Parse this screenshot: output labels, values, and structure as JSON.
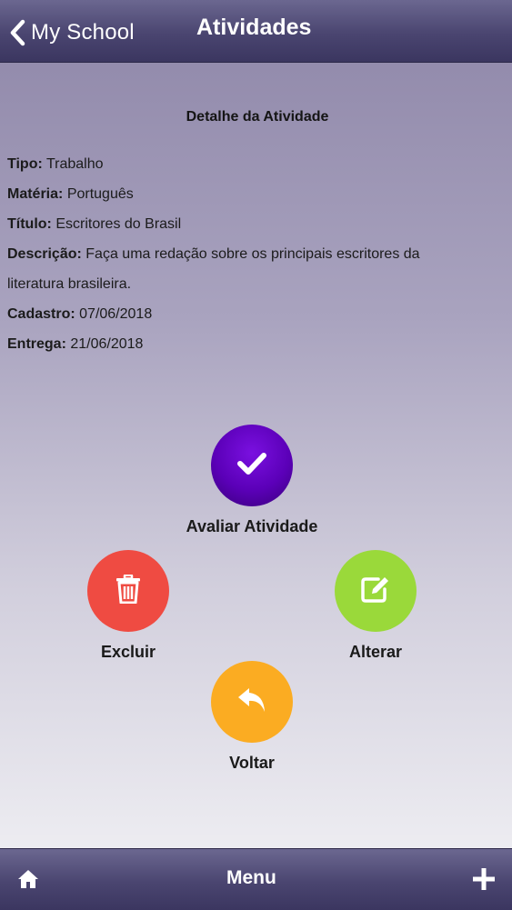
{
  "header": {
    "back_label": "My School",
    "title": "Atividades"
  },
  "detail": {
    "section_title": "Detalhe da Atividade",
    "fields": [
      {
        "label": "Tipo:",
        "value": "Trabalho"
      },
      {
        "label": "Matéria:",
        "value": "Português"
      },
      {
        "label": "Título:",
        "value": "Escritores do Brasil"
      },
      {
        "label": "Descrição:",
        "value": "Faça uma redação sobre os principais escritores da"
      },
      {
        "label": "",
        "value": "literatura brasileira."
      },
      {
        "label": "Cadastro:",
        "value": "07/06/2018"
      },
      {
        "label": "Entrega:",
        "value": "21/06/2018"
      }
    ]
  },
  "actions": {
    "evaluate": {
      "label": "Avaliar Atividade",
      "icon": "check-icon",
      "color": "#5b00b8"
    },
    "delete": {
      "label": "Excluir",
      "icon": "trash-icon",
      "color": "#ef4b42"
    },
    "edit": {
      "label": "Alterar",
      "icon": "edit-icon",
      "color": "#9ad93a"
    },
    "back": {
      "label": "Voltar",
      "icon": "reply-icon",
      "color": "#fbac22"
    }
  },
  "footer": {
    "home_icon": "home-icon",
    "menu_label": "Menu",
    "add_icon": "plus-icon"
  }
}
